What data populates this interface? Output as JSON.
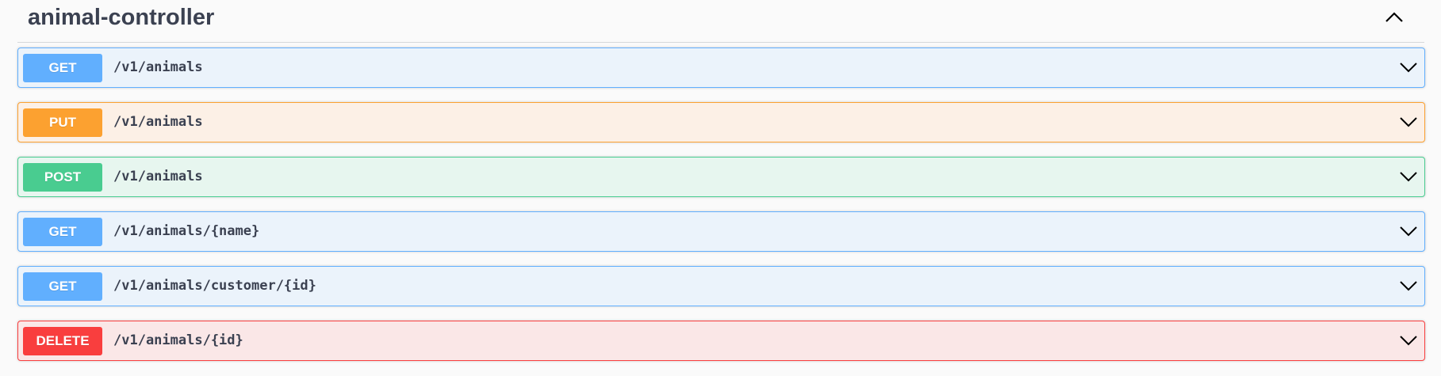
{
  "tag": {
    "title": "animal-controller",
    "collapse_icon": "chevron-up-icon"
  },
  "operations": [
    {
      "method": "GET",
      "path": "/v1/animals",
      "expand_icon": "chevron-down-icon"
    },
    {
      "method": "PUT",
      "path": "/v1/animals",
      "expand_icon": "chevron-down-icon"
    },
    {
      "method": "POST",
      "path": "/v1/animals",
      "expand_icon": "chevron-down-icon"
    },
    {
      "method": "GET",
      "path": "/v1/animals/{name}",
      "expand_icon": "chevron-down-icon"
    },
    {
      "method": "GET",
      "path": "/v1/animals/customer/{id}",
      "expand_icon": "chevron-down-icon"
    },
    {
      "method": "DELETE",
      "path": "/v1/animals/{id}",
      "expand_icon": "chevron-down-icon"
    }
  ],
  "colors": {
    "get": "#61affe",
    "put": "#fca130",
    "post": "#49cc90",
    "delete": "#f93e3e",
    "text": "#3b4151"
  }
}
